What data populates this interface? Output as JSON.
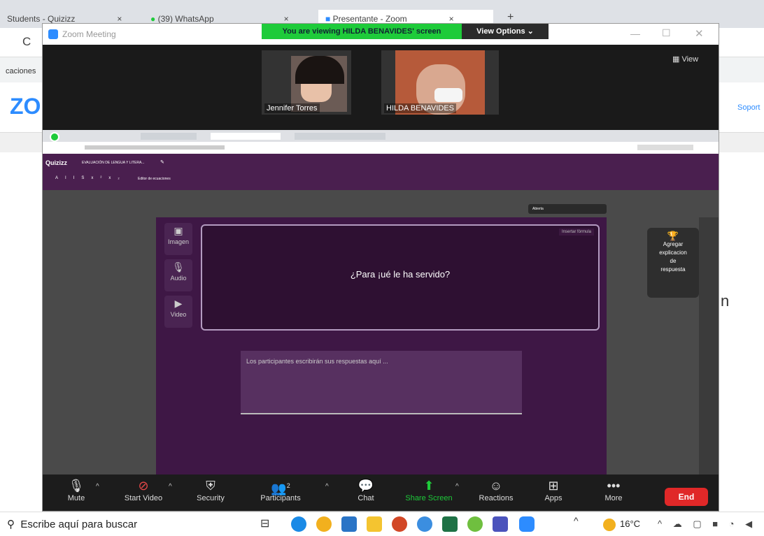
{
  "bg_browser": {
    "tabs": [
      {
        "label": "Students - Quizizz",
        "close": "×"
      },
      {
        "label": "(39) WhatsApp",
        "close": "×"
      },
      {
        "label": "Presentante - Zoom",
        "close": "×"
      }
    ],
    "new_tab": "+",
    "reload": "C",
    "bookmark_text": "caciones",
    "logo": "ZO",
    "support": "Soport",
    "stray_letter": "n"
  },
  "zoom": {
    "title": "Zoom Meeting",
    "banner": "You are viewing HILDA BENAVIDES' screen",
    "view_options": "View Options ⌄",
    "view_button": "View",
    "participants_video": [
      {
        "name": "Jennifer Torres"
      },
      {
        "name": "HILDA BENAVIDES"
      }
    ],
    "toolbar": [
      {
        "label": "Mute",
        "icon": "microphone-icon"
      },
      {
        "label": "Start Video",
        "icon": "video-off-icon"
      },
      {
        "label": "Security",
        "icon": "shield-icon"
      },
      {
        "label": "Participants",
        "icon": "participants-icon",
        "count": "2"
      },
      {
        "label": "Chat",
        "icon": "chat-icon"
      },
      {
        "label": "Share Screen",
        "icon": "share-screen-icon"
      },
      {
        "label": "Reactions",
        "icon": "reactions-icon"
      },
      {
        "label": "Apps",
        "icon": "apps-icon"
      },
      {
        "label": "More",
        "icon": "more-icon"
      }
    ],
    "end_label": "End"
  },
  "shared": {
    "app_name": "Quizizz",
    "quiz_title": "EVALUACIÓN DE LENGUA Y LITERA...",
    "toolbar_fmt": [
      "A",
      "I",
      "I",
      "S",
      "x²",
      "x₂"
    ],
    "equation_editor": "Editor de ecuaciones",
    "dropdown_label": "Abierta",
    "insert_formula": "Insertar fórmula",
    "side_buttons": [
      "Imagen",
      "Audio",
      "Video"
    ],
    "question": "¿Para ¡ué le ha servido?",
    "answer_placeholder": "Los participantes escribirán sus respuestas aquí ...",
    "explain_lines": [
      "Agregar",
      "explicacion",
      "de",
      "respuesta"
    ]
  },
  "taskbar": {
    "search": "Escribe aquí para buscar",
    "temperature": "16°C"
  },
  "colors": {
    "quizizz_purple": "#4a1f4f",
    "zoom_green": "#1ecb3a",
    "end_red": "#e02828"
  }
}
